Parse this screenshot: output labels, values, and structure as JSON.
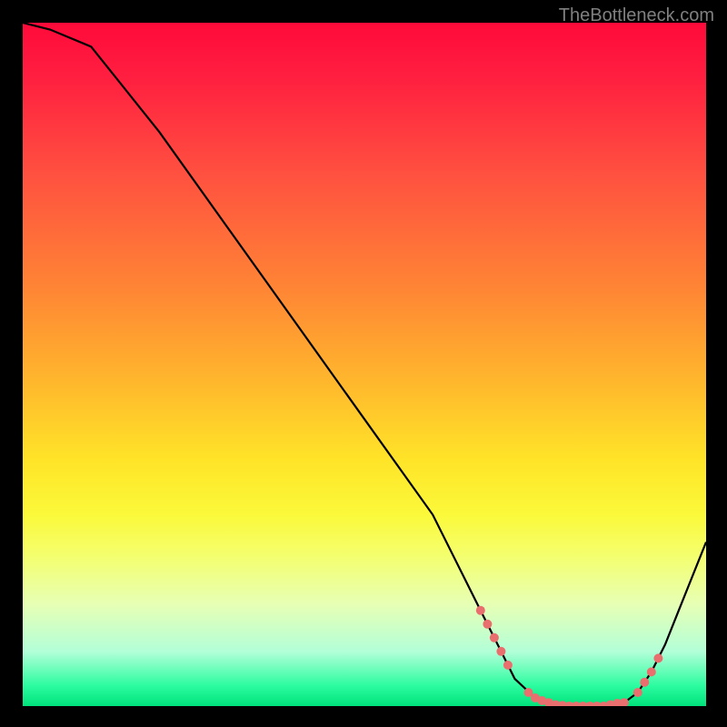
{
  "watermark": "TheBottleneck.com",
  "chart_data": {
    "type": "line",
    "title": "",
    "xlabel": "",
    "ylabel": "",
    "xlim": [
      0,
      100
    ],
    "ylim": [
      0,
      100
    ],
    "series": [
      {
        "name": "curve",
        "x": [
          0,
          4,
          10,
          20,
          30,
          40,
          50,
          60,
          67,
          70,
          72,
          75,
          78,
          80,
          82,
          85,
          88,
          90,
          92,
          94,
          96,
          100
        ],
        "y": [
          100,
          99,
          96.5,
          84,
          70,
          56,
          42,
          28,
          14,
          8,
          4,
          1.2,
          0.2,
          0,
          0,
          0,
          0.5,
          2,
          5,
          9,
          14,
          24
        ]
      }
    ],
    "markers": {
      "name": "dots",
      "color": "#e96f6f",
      "x": [
        67,
        68,
        69,
        70,
        71,
        74,
        75,
        76,
        77,
        78,
        79,
        80,
        81,
        82,
        83,
        84,
        85,
        86,
        87,
        88,
        90,
        91,
        92,
        93
      ],
      "y": [
        14,
        12,
        10,
        8,
        6,
        2,
        1.2,
        0.8,
        0.5,
        0.2,
        0.1,
        0,
        0,
        0,
        0,
        0,
        0,
        0.2,
        0.4,
        0.5,
        2,
        3.5,
        5,
        7
      ]
    },
    "gradient_stops": [
      {
        "pos": 0,
        "color": "#ff0a3a"
      },
      {
        "pos": 22,
        "color": "#ff5040"
      },
      {
        "pos": 52,
        "color": "#ffb52d"
      },
      {
        "pos": 72,
        "color": "#fbf93a"
      },
      {
        "pos": 92,
        "color": "#b3ffd8"
      },
      {
        "pos": 100,
        "color": "#00e27b"
      }
    ]
  }
}
